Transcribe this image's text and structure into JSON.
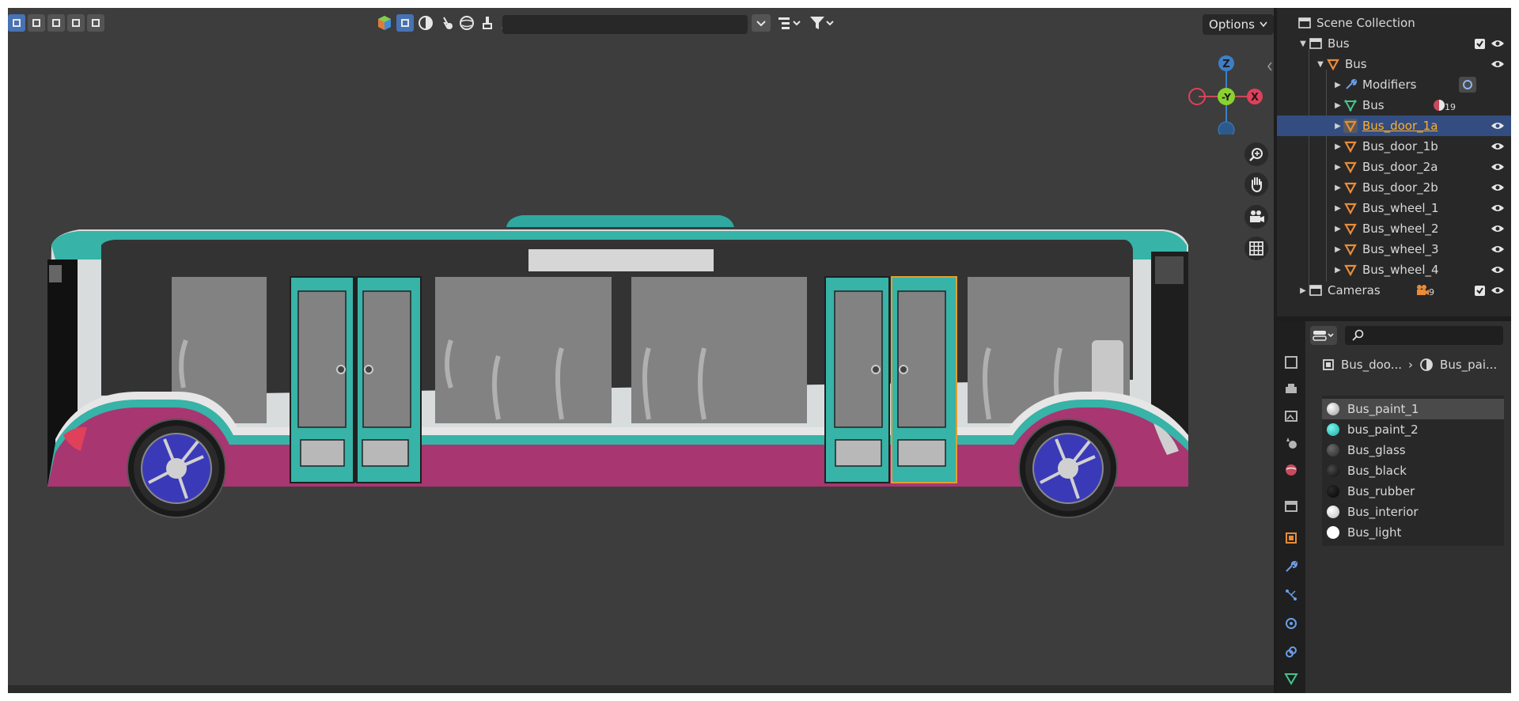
{
  "viewport": {
    "options_label": "Options",
    "gizmo": {
      "z": "Z",
      "neg_y": "-Y",
      "x": "X"
    }
  },
  "outliner": {
    "rows": [
      {
        "label": "Scene Collection"
      },
      {
        "label": "Bus"
      },
      {
        "label": "Bus"
      },
      {
        "label": "Modifiers"
      },
      {
        "label": "Bus",
        "badge": "19"
      },
      {
        "label": "Bus_door_1a"
      },
      {
        "label": "Bus_door_1b"
      },
      {
        "label": "Bus_door_2a"
      },
      {
        "label": "Bus_door_2b"
      },
      {
        "label": "Bus_wheel_1"
      },
      {
        "label": "Bus_wheel_2"
      },
      {
        "label": "Bus_wheel_3"
      },
      {
        "label": "Bus_wheel_4"
      },
      {
        "label": "Cameras",
        "badge": "9"
      }
    ]
  },
  "properties": {
    "breadcrumb": {
      "object": "Bus_doo...",
      "separator": "›",
      "material": "Bus_pai..."
    },
    "materials": [
      {
        "name": "Bus_paint_1",
        "color": "#e8e8e8"
      },
      {
        "name": "bus_paint_2",
        "color": "#2fd3c8"
      },
      {
        "name": "Bus_glass",
        "color": "#3a3a3a"
      },
      {
        "name": "Bus_black",
        "color": "#111111"
      },
      {
        "name": "Bus_rubber",
        "color": "#0d0d0d"
      },
      {
        "name": "Bus_interior",
        "color": "#f2f2f2"
      },
      {
        "name": "Bus_light",
        "color": "#ffffff"
      }
    ]
  },
  "colors": {
    "bus_teal": "#37b3a8",
    "bus_magenta": "#a83671",
    "wheel_blue": "#3a3ab8",
    "selection_orange": "#e0a030",
    "selected_row": "#334d80",
    "active_text": "#ffaf29"
  }
}
